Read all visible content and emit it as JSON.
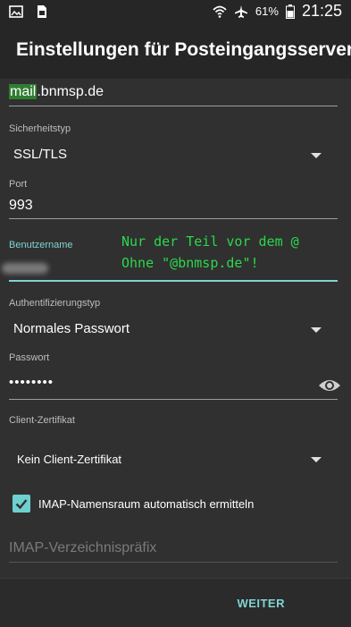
{
  "status_bar": {
    "icons_left": [
      "image-icon",
      "sim-icon"
    ],
    "icons_right": [
      "wifi-icon",
      "airplane-icon",
      "battery-icon"
    ],
    "battery": "61%",
    "time": "21:25"
  },
  "header": {
    "title": "Einstellungen für Posteingangsserver"
  },
  "fields": {
    "server": {
      "value_highlight": "mail",
      "value_rest": ".bnmsp.de"
    },
    "security": {
      "label": "Sicherheitstyp",
      "value": "SSL/TLS"
    },
    "port": {
      "label": "Port",
      "value": "993"
    },
    "username": {
      "label": "Benutzername",
      "value": ""
    },
    "auth": {
      "label": "Authentifizierungstyp",
      "value": "Normales Passwort"
    },
    "password": {
      "label": "Passwort",
      "value": "••••••••"
    },
    "client_cert": {
      "label": "Client-Zertifikat",
      "value": "Kein Client-Zertifikat"
    }
  },
  "annotation": {
    "line1": "Nur der Teil vor dem @",
    "line2": "Ohne \"@bnmsp.de\"!"
  },
  "checkbox": {
    "label": "IMAP-Namensraum automatisch ermitteln",
    "checked": true
  },
  "prefix": {
    "placeholder": "IMAP-Verzeichnispräfix"
  },
  "footer": {
    "next_label": "WEITER"
  },
  "colors": {
    "accent": "#7fd3d1",
    "annotation": "#2bd84b",
    "highlight": "#2f7d32"
  }
}
